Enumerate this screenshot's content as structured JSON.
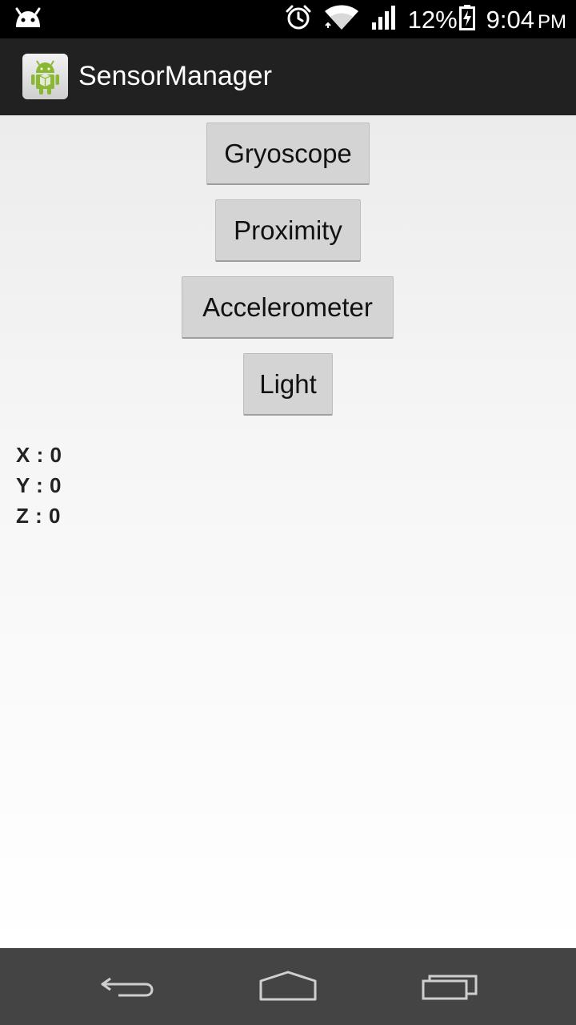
{
  "status_bar": {
    "battery_percent": "12%",
    "time": "9:04",
    "ampm": "PM",
    "icons": [
      "android-notification-icon",
      "alarm-icon",
      "wifi-icon",
      "signal-icon",
      "battery-charging-icon"
    ]
  },
  "action_bar": {
    "title": "SensorManager",
    "icon": "android-app-icon"
  },
  "buttons": {
    "gyroscope": "Gryoscope",
    "proximity": "Proximity",
    "accelerometer": "Accelerometer",
    "light": "Light"
  },
  "readings": {
    "x": "X : 0",
    "y": "Y : 0",
    "z": "Z : 0"
  },
  "nav_bar": {
    "icons": [
      "back-icon",
      "home-icon",
      "recent-apps-icon"
    ]
  },
  "colors": {
    "status_bar": "#000000",
    "action_bar": "#212121",
    "nav_bar": "#444444",
    "button": "#d4d4d4"
  }
}
